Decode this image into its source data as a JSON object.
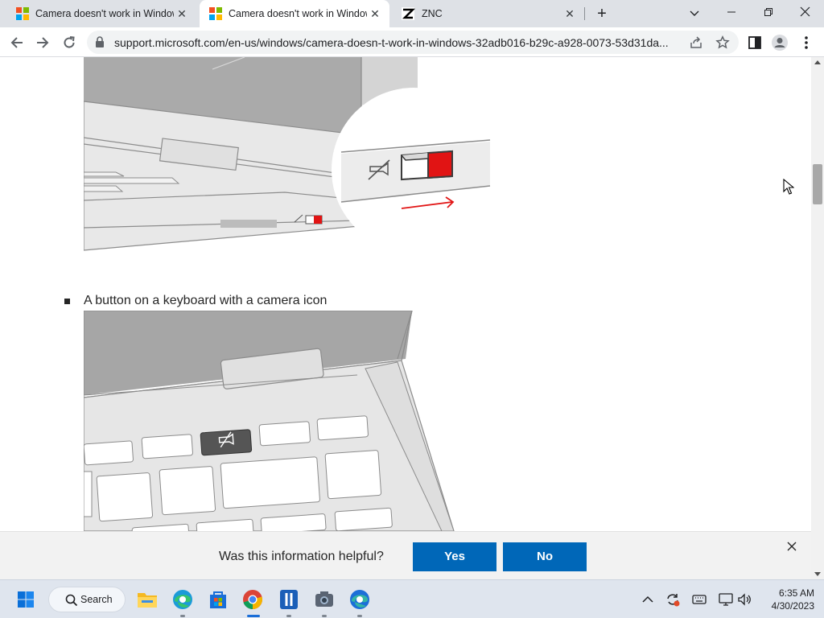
{
  "browser": {
    "tabs": [
      {
        "title": "Camera doesn't work in Windows",
        "active": false
      },
      {
        "title": "Camera doesn't work in Windows",
        "active": true
      },
      {
        "title": "ZNC",
        "active": false
      }
    ],
    "address": "support.microsoft.com/en-us/windows/camera-doesn-t-work-in-windows-32adb016-b29c-a928-0073-53d31da...",
    "window_controls": [
      "chevron-down-icon",
      "minimize-icon",
      "restore-icon",
      "close-icon"
    ],
    "toolbar_icons": [
      "back-icon",
      "forward-icon",
      "reload-icon",
      "lock-icon",
      "share-icon",
      "star-icon",
      "side-panel-icon",
      "profile-icon",
      "menu-icon"
    ]
  },
  "content": {
    "list_item_text": "A button on a keyboard with a camera icon",
    "accent_red": "#e11414"
  },
  "feedback": {
    "question": "Was this information helpful?",
    "yes_label": "Yes",
    "no_label": "No",
    "button_color": "#0067b8"
  },
  "taskbar": {
    "search_label": "Search",
    "apps": [
      "start-icon",
      "search-icon",
      "file-explorer-icon",
      "edge-icon",
      "microsoft-store-icon",
      "chrome-icon",
      "remote-app-icon",
      "camera-app-icon",
      "edge-dev-icon"
    ],
    "tray_icons": [
      "chevron-up-icon",
      "sync-icon",
      "keyboard-icon",
      "network-icon",
      "volume-icon"
    ],
    "time": "6:35 AM",
    "date": "4/30/2023"
  }
}
